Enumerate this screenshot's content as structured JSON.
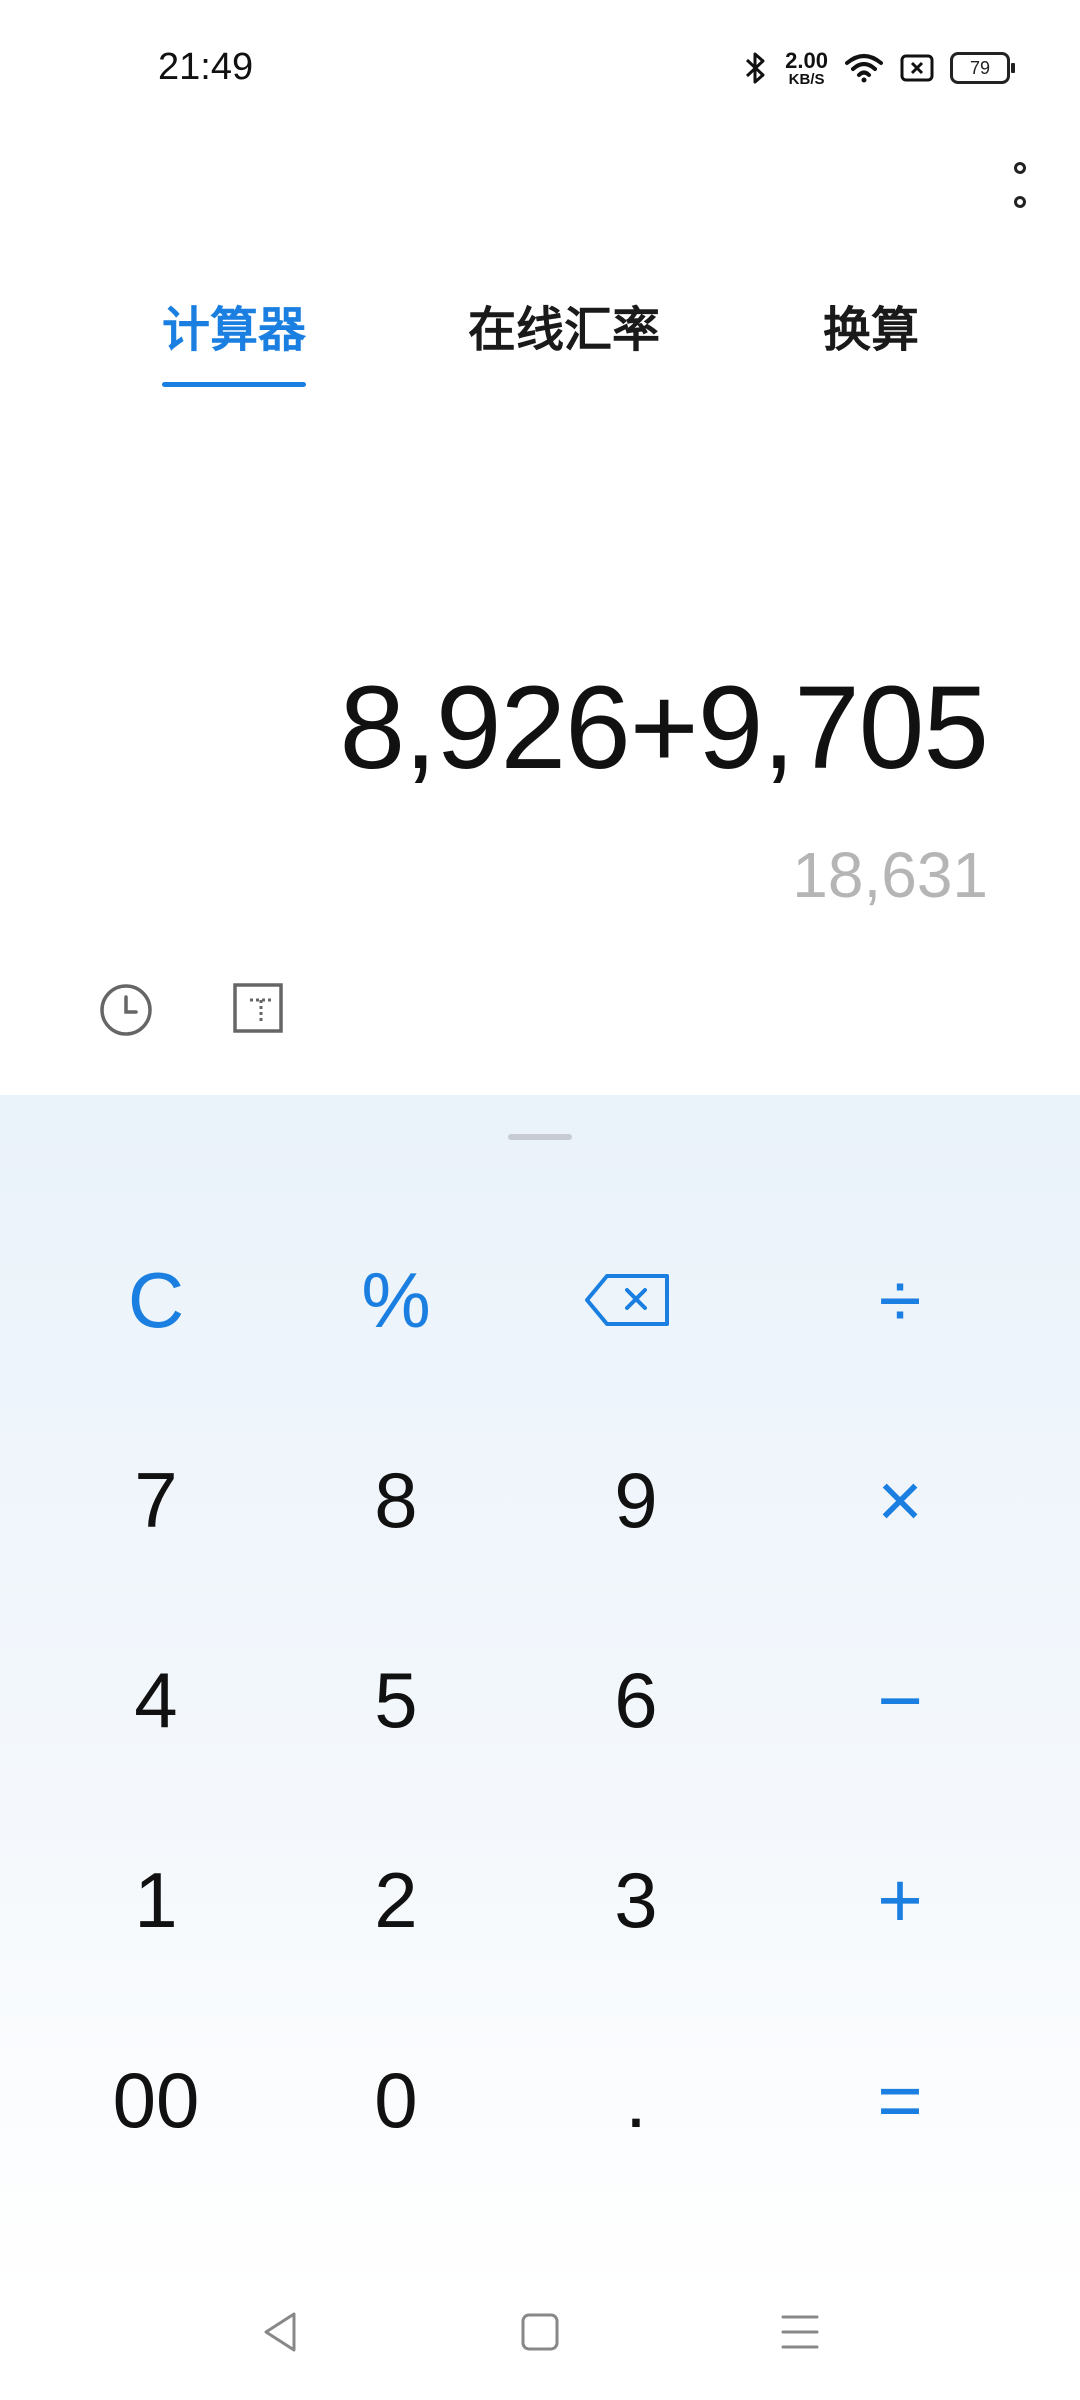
{
  "status_bar": {
    "time": "21:49",
    "net_speed_value": "2.00",
    "net_speed_unit": "KB/S",
    "battery": "79",
    "icons": [
      "bluetooth-icon",
      "wifi-icon",
      "sim-disabled-icon",
      "battery-icon"
    ]
  },
  "tabs": [
    {
      "label": "计算器",
      "active": true
    },
    {
      "label": "在线汇率",
      "active": false
    },
    {
      "label": "换算",
      "active": false
    }
  ],
  "display": {
    "expression": "8,926+9,705",
    "result": "18,631"
  },
  "toolbar": {
    "icons": [
      "history-clock-icon",
      "scientific-mode-icon",
      "more-vertical-icon"
    ]
  },
  "keypad": {
    "rows": [
      [
        "C",
        "%",
        "⌫",
        "÷"
      ],
      [
        "7",
        "8",
        "9",
        "×"
      ],
      [
        "4",
        "5",
        "6",
        "−"
      ],
      [
        "1",
        "2",
        "3",
        "+"
      ],
      [
        "00",
        "0",
        ".",
        "="
      ]
    ]
  },
  "nav_bar": {
    "icons": [
      "back-triangle-icon",
      "home-square-icon",
      "recents-menu-icon"
    ]
  },
  "colors": {
    "accent": "#1a7fe0",
    "result_gray": "#b5b5b5",
    "keypad_bg": "#eaf2fa"
  }
}
